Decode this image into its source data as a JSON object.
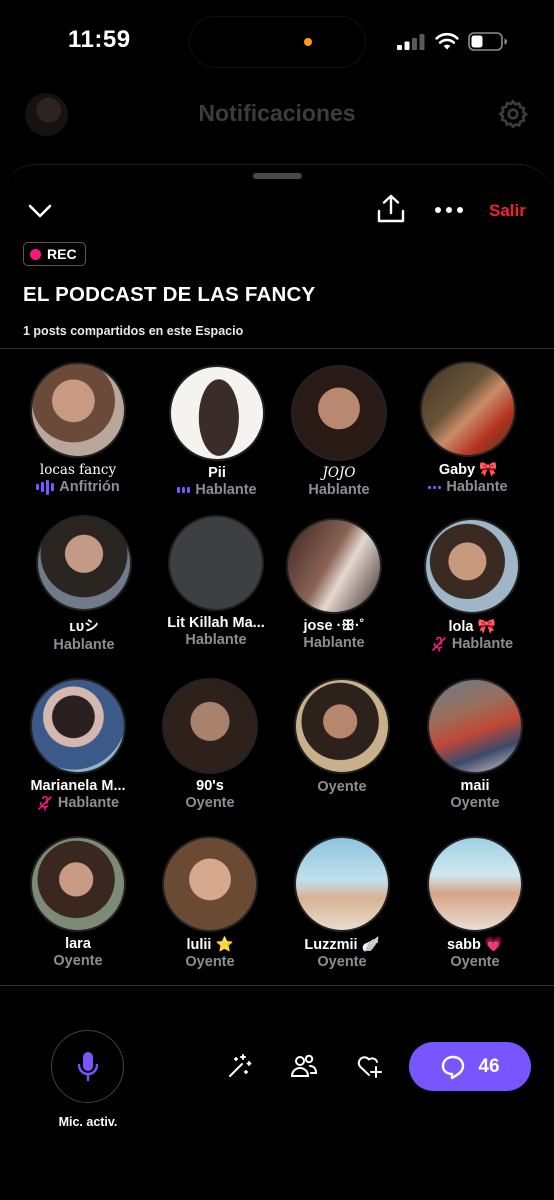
{
  "status_bar": {
    "time": "11:59"
  },
  "background_header": {
    "title": "Notificaciones"
  },
  "sheet": {
    "exit_label": "Salir",
    "rec_label": "REC",
    "title": "EL PODCAST DE LAS FANCY",
    "posts_shared": "1 posts compartidos en este Espacio"
  },
  "participants": [
    {
      "name": "locas fancy",
      "role": "Anfitrión",
      "indicator": "speaking"
    },
    {
      "name": "Pii",
      "role": "Hablante",
      "indicator": "dots"
    },
    {
      "name": "JOJO",
      "role": "Hablante",
      "indicator": "none"
    },
    {
      "name": "Gaby 🎀",
      "role": "Hablante",
      "indicator": "dots"
    },
    {
      "name": "ʟᴜシ",
      "role": "Hablante",
      "indicator": "none"
    },
    {
      "name": "Lit Killah Ma...",
      "role": "Hablante",
      "indicator": "none"
    },
    {
      "name": "jose ·ꕥ·˚",
      "role": "Hablante",
      "indicator": "none"
    },
    {
      "name": "lola 🎀",
      "role": "Hablante",
      "indicator": "muted"
    },
    {
      "name": "Marianela M...",
      "role": "Hablante",
      "indicator": "muted"
    },
    {
      "name": "90's",
      "role": "Oyente",
      "indicator": "none"
    },
    {
      "name": "",
      "role": "Oyente",
      "indicator": "none"
    },
    {
      "name": "maii",
      "role": "Oyente",
      "indicator": "none"
    },
    {
      "name": "lara",
      "role": "Oyente",
      "indicator": "none"
    },
    {
      "name": "lulii ⭐",
      "role": "Oyente",
      "indicator": "none"
    },
    {
      "name": "Luzzmii 🪽",
      "role": "Oyente",
      "indicator": "none"
    },
    {
      "name": "sabb 💗",
      "role": "Oyente",
      "indicator": "none"
    }
  ],
  "bottom_bar": {
    "mic_label": "Mic. activ.",
    "comments_count": "46",
    "icons": [
      "magic-wand-icon",
      "people-icon",
      "heart-plus-icon",
      "comment-icon",
      "microphone-icon"
    ]
  },
  "colors": {
    "accent": "#7856ff",
    "exit": "#f4212e",
    "rec": "#f91880",
    "role_text": "#8b8f94"
  }
}
